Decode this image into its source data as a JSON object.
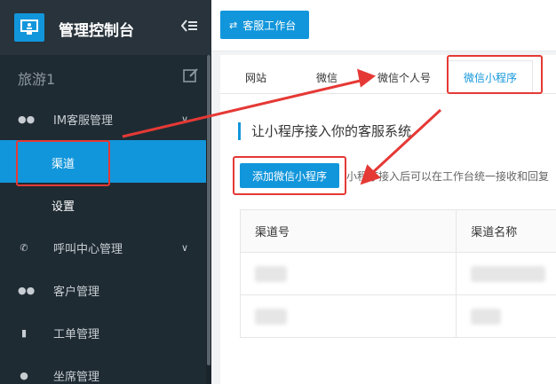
{
  "app": {
    "title": "管理控制台"
  },
  "tenant": {
    "name": "旅游1"
  },
  "sidebar": {
    "menu": [
      {
        "label": "IM客服管理",
        "icon": "chat-icon",
        "expanded": true
      },
      {
        "label": "渠道",
        "active": true
      },
      {
        "label": "设置"
      },
      {
        "label": "呼叫中心管理",
        "icon": "phone-icon"
      },
      {
        "label": "客户管理",
        "icon": "users-icon"
      },
      {
        "label": "工单管理",
        "icon": "document-icon"
      },
      {
        "label": "坐席管理",
        "icon": "user-icon"
      }
    ]
  },
  "topbar": {
    "workbench_label": "客服工作台"
  },
  "tabs": [
    {
      "label": "网站"
    },
    {
      "label": "微信"
    },
    {
      "label": "微信个人号"
    },
    {
      "label": "微信小程序",
      "active": true
    }
  ],
  "section": {
    "title": "让小程序接入你的客服系统",
    "add_button": "添加微信小程序",
    "hint": "小程序接入后可以在工作台统一接收和回复"
  },
  "table": {
    "headers": [
      "渠道号",
      "渠道名称"
    ]
  },
  "colors": {
    "accent": "#1296db",
    "annotation": "#e53935",
    "sidebar_bg": "#1f2b33"
  }
}
